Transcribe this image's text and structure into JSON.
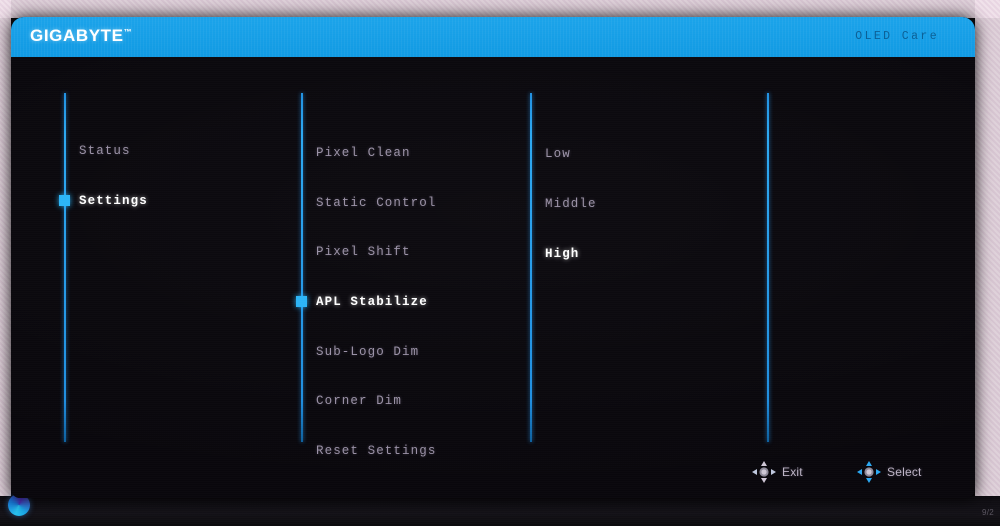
{
  "header": {
    "brand": "GIGABYTE",
    "brand_tm": "™",
    "section_title": "OLED Care",
    "bar_color": "#129ce6",
    "title_color": "#0a5e95"
  },
  "colors": {
    "panel_bg": "#09070c",
    "rail": "#2aa8f2",
    "marker": "#2ab4f7",
    "text_dim": "#9a91a6",
    "text_active": "#ffffff"
  },
  "columns": {
    "level1": {
      "name": "main-menu",
      "items": [
        {
          "label": "Status",
          "selected": false
        },
        {
          "label": "Settings",
          "selected": true
        }
      ]
    },
    "level2": {
      "name": "settings-menu",
      "items": [
        {
          "label": "Pixel Clean",
          "selected": false
        },
        {
          "label": "Static Control",
          "selected": false
        },
        {
          "label": "Pixel Shift",
          "selected": false
        },
        {
          "label": "APL Stabilize",
          "selected": true
        },
        {
          "label": "Sub-Logo Dim",
          "selected": false
        },
        {
          "label": "Corner Dim",
          "selected": false
        },
        {
          "label": "Reset Settings",
          "selected": false
        }
      ]
    },
    "level3": {
      "name": "apl-stabilize-options",
      "items": [
        {
          "label": "Low",
          "selected": false
        },
        {
          "label": "Middle",
          "selected": false
        },
        {
          "label": "High",
          "selected": true
        }
      ]
    }
  },
  "footer": {
    "hints": [
      {
        "icon": "joystick-icon",
        "label": "Exit",
        "arrow_color": "#cfc7d6"
      },
      {
        "icon": "joystick-icon",
        "label": "Select",
        "arrow_color": "#2aa8f2"
      }
    ]
  },
  "desktop": {
    "taskbar_icon": "edge-browser-icon",
    "clock": "9/2"
  }
}
